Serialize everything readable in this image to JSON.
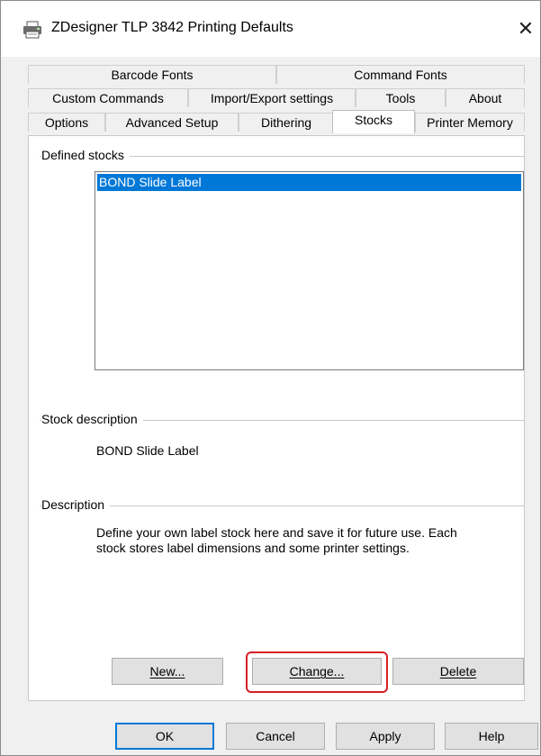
{
  "window": {
    "title": "ZDesigner TLP 3842 Printing Defaults",
    "close_symbol": "✕",
    "icon": "printer-icon"
  },
  "tabs": {
    "row1": [
      "Barcode Fonts",
      "Command Fonts"
    ],
    "row2": [
      "Custom Commands",
      "Import/Export settings",
      "Tools",
      "About"
    ],
    "row3": [
      "Options",
      "Advanced Setup",
      "Dithering",
      "Stocks",
      "Printer Memory"
    ],
    "active": "Stocks"
  },
  "stocks": {
    "defined_label": "Defined stocks",
    "items": [
      "BOND Slide Label"
    ],
    "stock_description_label": "Stock description",
    "stock_description_value": "BOND Slide Label",
    "description_label": "Description",
    "description_line1": "Define your own label stock here and save it for future use. Each",
    "description_line2": "stock stores label dimensions and some printer settings."
  },
  "panel_buttons": {
    "new": "New...",
    "change": "Change...",
    "delete": "Delete"
  },
  "dialog_buttons": {
    "ok": "OK",
    "cancel": "Cancel",
    "apply": "Apply",
    "help": "Help"
  },
  "colors": {
    "selection": "#0078d7",
    "highlight_box": "#d71f26"
  }
}
